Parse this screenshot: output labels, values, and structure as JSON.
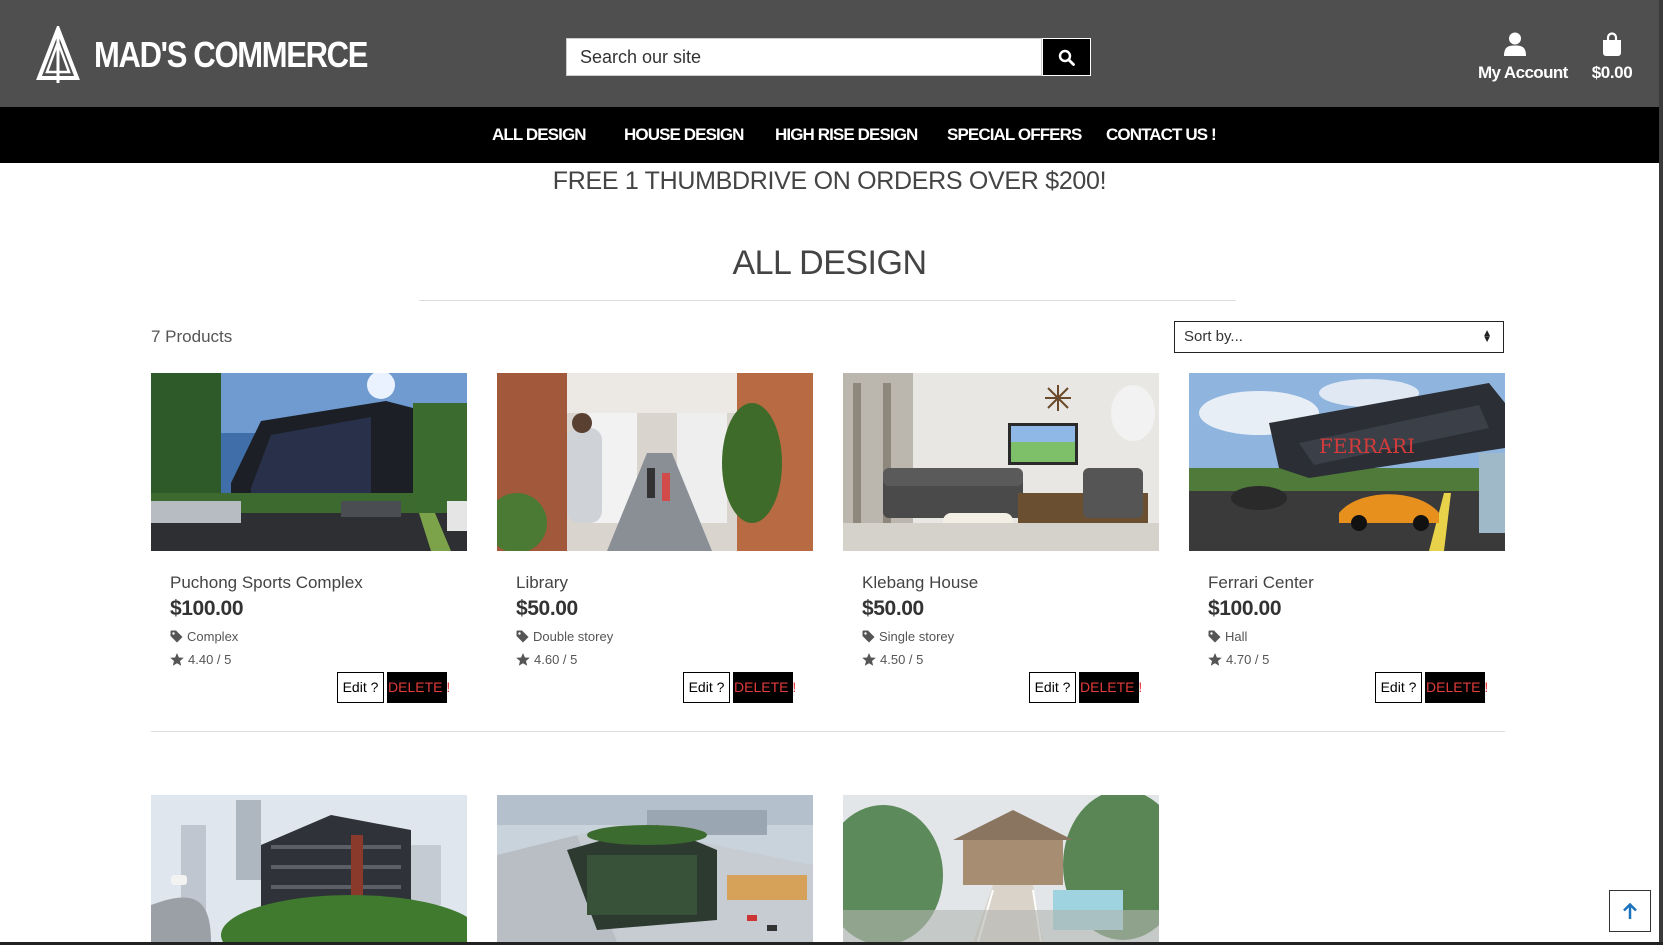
{
  "header": {
    "logo_text": "MAD'S COMMERCE",
    "search": {
      "placeholder": "Search our site"
    },
    "account_label": "My Account",
    "cart_total": "$0.00"
  },
  "nav": [
    {
      "label": "ALL DESIGN"
    },
    {
      "label": "HOUSE DESIGN"
    },
    {
      "label": "HIGH RISE DESIGN"
    },
    {
      "label": "SPECIAL OFFERS"
    },
    {
      "label": "CONTACT US !"
    }
  ],
  "promo": "FREE 1 THUMBDRIVE ON ORDERS OVER $200!",
  "page_title": "ALL DESIGN",
  "product_count": "7 Products",
  "sort": {
    "selected": "Sort by..."
  },
  "buttons": {
    "edit": "Edit ?",
    "delete": "DELETE !"
  },
  "products": [
    {
      "name": "Puchong Sports Complex",
      "price": "$100.00",
      "category": "Complex",
      "rating": "4.40 / 5"
    },
    {
      "name": "Library",
      "price": "$50.00",
      "category": "Double storey",
      "rating": "4.60 / 5"
    },
    {
      "name": "Klebang House",
      "price": "$50.00",
      "category": "Single storey",
      "rating": "4.50 / 5"
    },
    {
      "name": "Ferrari Center",
      "price": "$100.00",
      "category": "Hall",
      "rating": "4.70 / 5"
    }
  ],
  "colors": {
    "topbar": "#4f4f4f",
    "navbar": "#000000",
    "delete_text": "#e23b3b",
    "back_top_arrow": "#1e73be"
  },
  "icons": [
    "logo-triangle-icon",
    "search-icon",
    "user-icon",
    "shopping-bag-icon",
    "tag-icon",
    "star-icon",
    "arrow-up-icon",
    "sort-arrows-icon"
  ]
}
